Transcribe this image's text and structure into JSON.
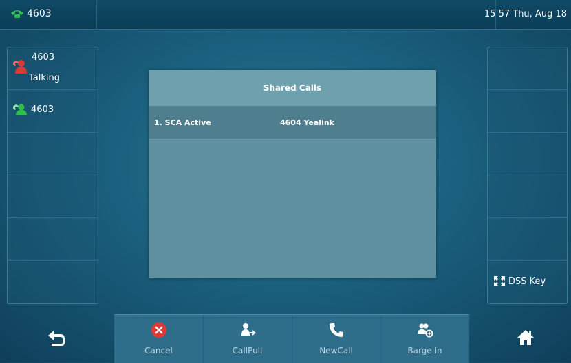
{
  "status_bar": {
    "line": "4603",
    "clock": "15 57 Thu, Aug 18"
  },
  "left_panel": {
    "slots": [
      {
        "title": "4603",
        "status": "Talking"
      },
      {
        "title": "4603"
      }
    ]
  },
  "right_panel": {
    "dss_key_label": "DSS Key"
  },
  "dialog": {
    "title": "Shared Calls",
    "rows": [
      {
        "status": "1. SCA Active",
        "party": "4604 Yealink"
      }
    ]
  },
  "softkeys": {
    "cancel": "Cancel",
    "callpull": "CallPull",
    "newcall": "NewCall",
    "barge_in": "Barge In"
  },
  "colors": {
    "cancel_red": "#e53935",
    "line_green": "#2fbf4a",
    "talking_red": "#d83a3a"
  }
}
